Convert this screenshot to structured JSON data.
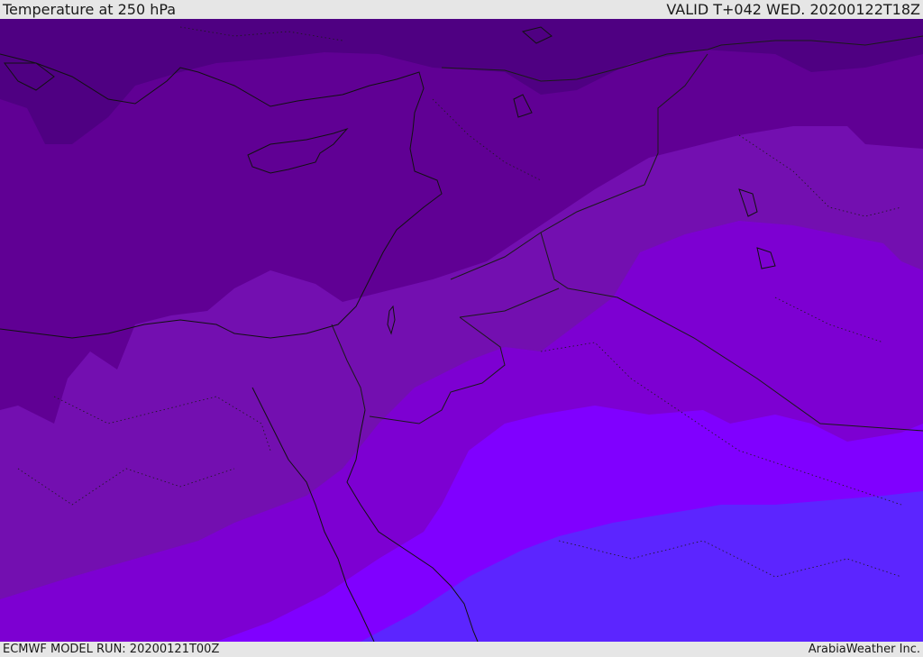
{
  "header": {
    "title": "Temperature at 250 hPa",
    "valid": "VALID T+042 WED. 20200122T18Z"
  },
  "footer": {
    "model_run": "ECMWF MODEL RUN: 20200121T00Z",
    "credit": "ArabiaWeather Inc."
  },
  "map": {
    "field": "temperature",
    "level": "250 hPa",
    "colors": {
      "band_darkest": "#4f0082",
      "band_dark": "#600094",
      "band_mid": "#730fb0",
      "band_violet": "#7d00d2",
      "band_bright": "#8000ff",
      "band_blue": "#5c25ff",
      "coastline": "#111111",
      "border": "#1a1a1a"
    }
  }
}
